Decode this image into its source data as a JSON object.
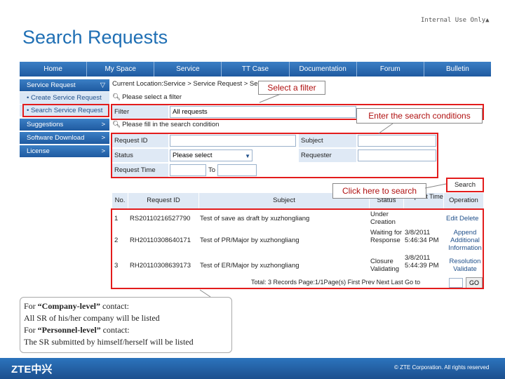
{
  "header": {
    "confidential": "Internal Use Only▲",
    "title": "Search Requests"
  },
  "nav": [
    "Home",
    "My Space",
    "Service",
    "TT Case",
    "Documentation",
    "Forum",
    "Bulletin"
  ],
  "sidebar": {
    "items": [
      {
        "label": "Service Request",
        "chev": "▽"
      },
      {
        "label": "• Create Service Request",
        "chev": ""
      },
      {
        "label": "• Search Service Request",
        "chev": ""
      },
      {
        "label": "Suggestions",
        "chev": ">"
      },
      {
        "label": "Software Download",
        "chev": ">"
      },
      {
        "label": "License",
        "chev": ">"
      }
    ]
  },
  "breadcrumb": "Current Location:Service > Service Request > Search Service Request",
  "filter_section": {
    "heading": "Please select a filter",
    "label": "Filter",
    "value": "All requests"
  },
  "search_section": {
    "heading": "Please fill in the search condition",
    "request_id_label": "Request ID",
    "subject_label": "Subject",
    "status_label": "Status",
    "status_value": "Please select",
    "requester_label": "Requester",
    "request_time_label": "Request Time",
    "to_label": "To"
  },
  "search_button": "Search",
  "table": {
    "headers": [
      "No.",
      "Request ID",
      "Subject",
      "Status",
      "Request Time",
      "Operation"
    ],
    "rows": [
      {
        "no": "1",
        "id": "RS20110216527790",
        "subject": "Test of save as draft by xuzhongliang",
        "status": "Under Creation",
        "time": "",
        "operation": "Edit Delete"
      },
      {
        "no": "2",
        "id": "RH20110308640171",
        "subject": "Test of PR/Major by xuzhongliang",
        "status": "Waiting for Response",
        "time": "3/8/2011 5:46:34 PM",
        "operation": "Append Additional Information"
      },
      {
        "no": "3",
        "id": "RH20110308639173",
        "subject": "Test of ER/Major by xuzhongliang",
        "status": "Closure Validating",
        "time": "3/8/2011 5:44:39 PM",
        "operation": "Resolution Validate"
      }
    ],
    "pager": "Total: 3 Records Page:1/1Page(s) First Prev Next Last Go to"
  },
  "callouts": {
    "filter": "Select a filter",
    "conditions": "Enter the search conditions",
    "search": "Click here to search"
  },
  "note": {
    "line1_pre": "For ",
    "line1_bold": "“Company-level”",
    "line1_post": " contact:",
    "line2": "All SR of his/her company will be listed",
    "line3_pre": "For ",
    "line3_bold": "“Personnel-level”",
    "line3_post": " contact:",
    "line4": "The SR submitted by himself/herself  will be listed"
  },
  "footer": {
    "logo": "ZTE中兴",
    "copyright": "© ZTE Corporation. All rights reserved"
  },
  "colors": {
    "accent": "#1f6fb4",
    "annotation": "#e31c1c"
  }
}
